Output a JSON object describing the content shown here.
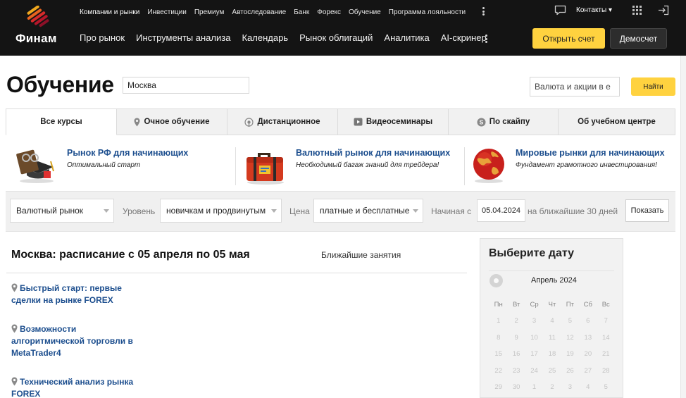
{
  "header": {
    "logo_text": "Финам",
    "subnav": [
      "Компании и рынки",
      "Инвестиции",
      "Премиум",
      "Автоследование",
      "Банк",
      "Форекс",
      "Обучение",
      "Программа лояльности"
    ],
    "mainnav": [
      "Про рынок",
      "Инструменты анализа",
      "Календарь",
      "Рынок облигаций",
      "Аналитика",
      "AI-скринер"
    ],
    "contacts_label": "Контакты ▾",
    "open_account_label": "Открыть счет",
    "demo_account_label": "Демосчет"
  },
  "page": {
    "title": "Обучение",
    "city_value": "Москва",
    "search_value": "Валюта и акции в е",
    "find_label": "Найти"
  },
  "tabs": [
    {
      "label": "Все курсы",
      "icon": "none"
    },
    {
      "label": "Очное обучение",
      "icon": "map-pin-icon"
    },
    {
      "label": "Дистанционное",
      "icon": "broadcast-icon"
    },
    {
      "label": "Видеосеминары",
      "icon": "play-icon"
    },
    {
      "label": "По скайпу",
      "icon": "skype-icon"
    },
    {
      "label": "Об учебном центре",
      "icon": "none"
    }
  ],
  "featured": [
    {
      "title": "Рынок РФ для начинающих",
      "subtitle": "Оптимальный старт",
      "icon": "graduation-cap-icon"
    },
    {
      "title": "Валютный рынок для начинающих",
      "subtitle": "Необходимый багаж знаний для трейдера!",
      "icon": "suitcase-icon"
    },
    {
      "title": "Мировые рынки для начинающих",
      "subtitle": "Фундамент грамотного инвестирования!",
      "icon": "globe-icon"
    }
  ],
  "filters": {
    "market_value": "Валютный рынок",
    "level_label": "Уровень",
    "level_value": "новичкам и продвинутым",
    "price_label": "Цена",
    "price_value": "платные и бесплатные",
    "start_label": "Начиная с",
    "start_date": "05.04.2024",
    "period_label": "на ближайшие 30 дней",
    "show_label": "Показать"
  },
  "schedule": {
    "title": "Москва: расписание с 05 апреля по 05 мая",
    "nearest_label": "Ближайшие занятия",
    "courses": [
      "Быстрый старт: первые сделки на рынке FOREX",
      "Возможности алгоритмической торговли в MetaTrader4",
      "Технический анализ рынка FOREX"
    ]
  },
  "calendar": {
    "title": "Выберите дату",
    "month": "Апрель 2024",
    "weekdays": [
      "Пн",
      "Вт",
      "Ср",
      "Чт",
      "Пт",
      "Сб",
      "Вс"
    ],
    "weeks": [
      [
        "1",
        "2",
        "3",
        "4",
        "5",
        "6",
        "7"
      ],
      [
        "8",
        "9",
        "10",
        "11",
        "12",
        "13",
        "14"
      ],
      [
        "15",
        "16",
        "17",
        "18",
        "19",
        "20",
        "21"
      ],
      [
        "22",
        "23",
        "24",
        "25",
        "26",
        "27",
        "28"
      ],
      [
        "29",
        "30",
        "1",
        "2",
        "3",
        "4",
        "5"
      ]
    ]
  },
  "colors": {
    "accent_yellow": "#ffd23f",
    "header_bg": "#141414",
    "link_blue": "#1c4e8e"
  }
}
